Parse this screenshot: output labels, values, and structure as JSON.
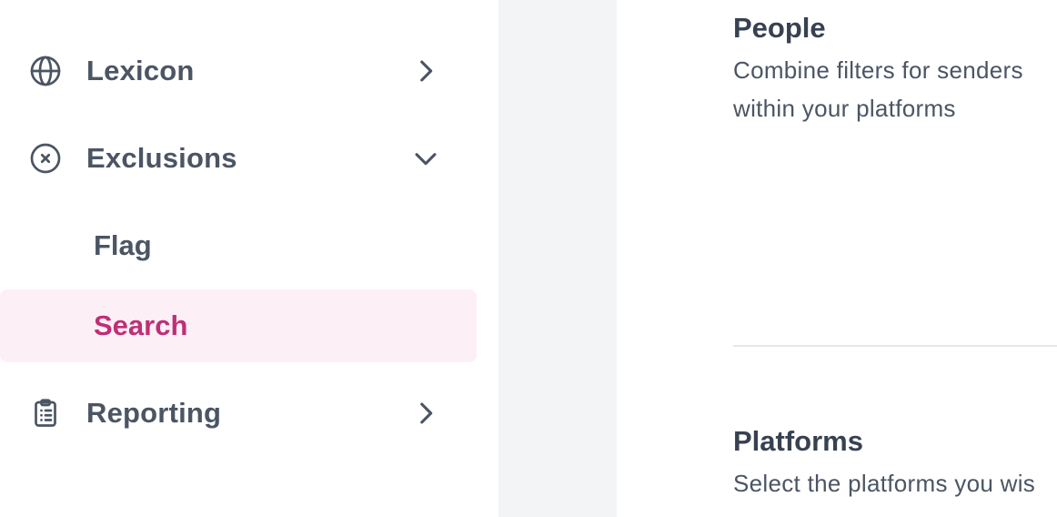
{
  "sidebar": {
    "items": [
      {
        "label": "Lexicon",
        "icon": "globe-icon",
        "chevron": "chevron-right-icon"
      },
      {
        "label": "Exclusions",
        "icon": "x-circle-icon",
        "chevron": "chevron-down-icon"
      },
      {
        "label": "Reporting",
        "icon": "clipboard-list-icon",
        "chevron": "chevron-right-icon"
      }
    ],
    "subitems": [
      {
        "label": "Flag"
      },
      {
        "label": "Search",
        "active": true
      }
    ]
  },
  "content": {
    "people": {
      "title": "People",
      "desc_line1": "Combine filters for senders",
      "desc_line2": "within your platforms"
    },
    "platforms": {
      "title": "Platforms",
      "desc_line1": "Select the platforms you wis"
    }
  },
  "colors": {
    "accent": "#be2f77",
    "active_bg": "#fcf0f6",
    "text": "#4b5563",
    "gutter": "#f3f4f6"
  }
}
